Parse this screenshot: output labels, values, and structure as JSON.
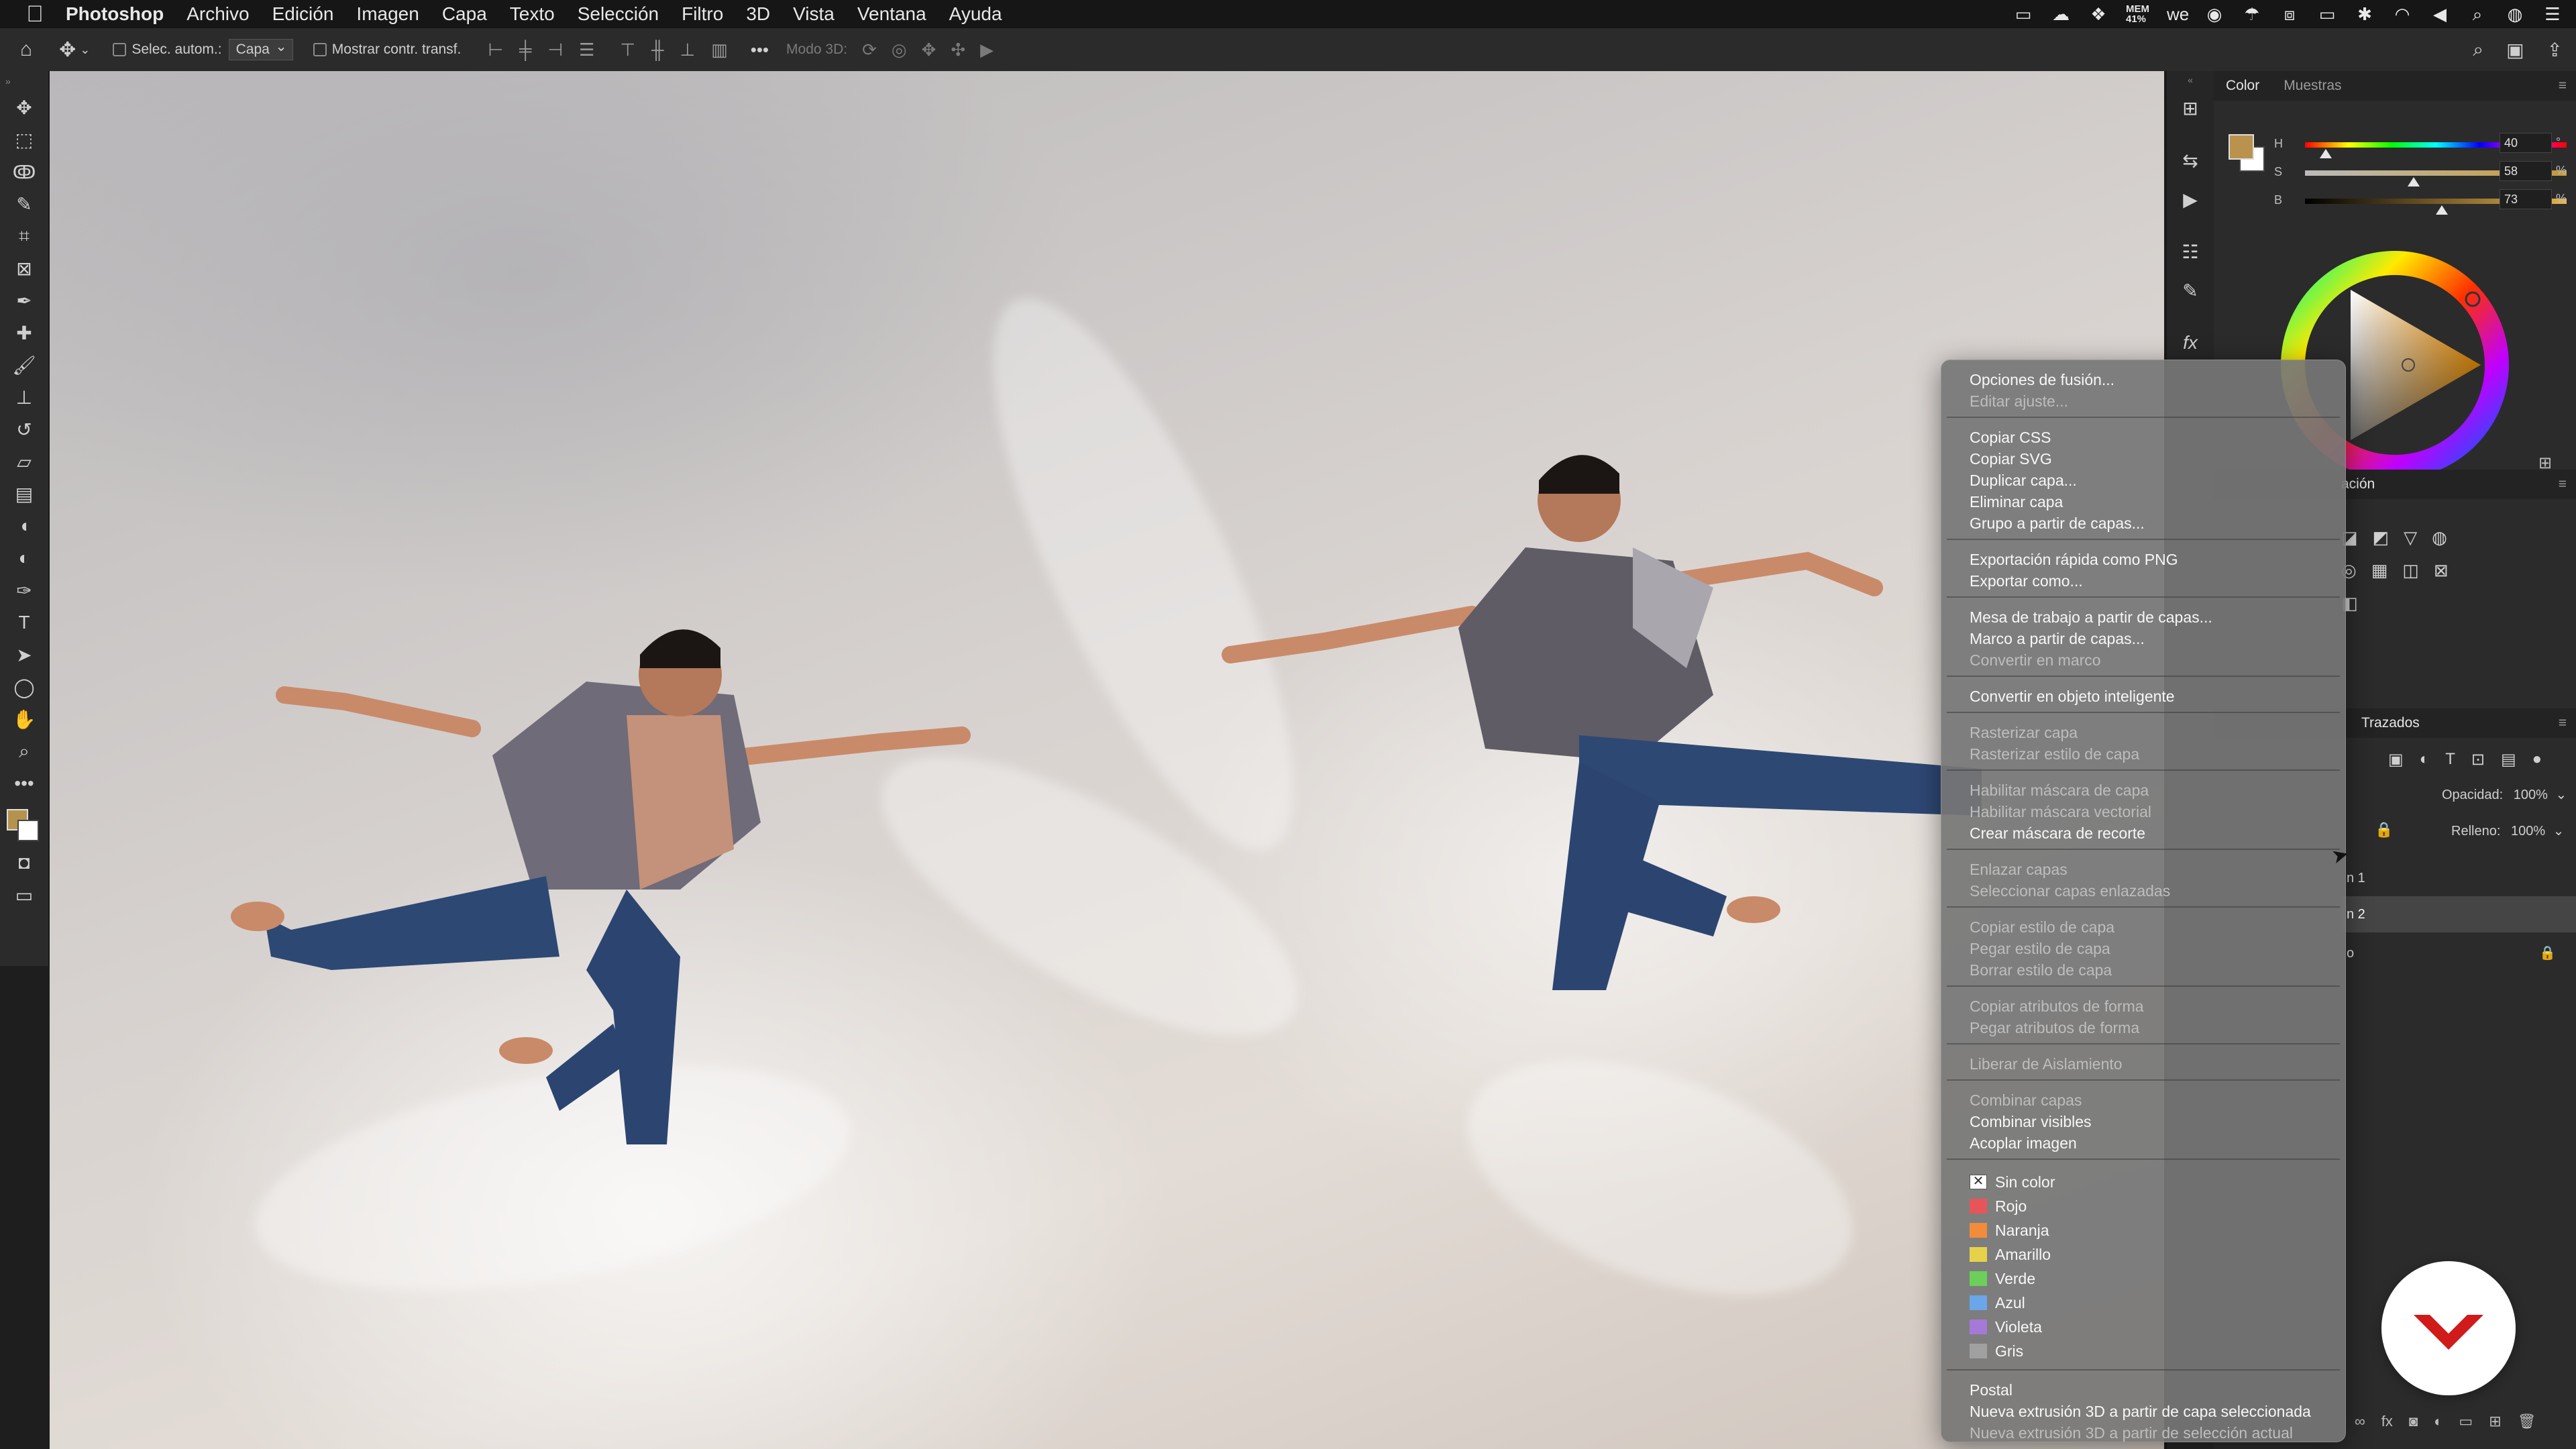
{
  "menubar": {
    "app_name": "Photoshop",
    "menus": [
      "Archivo",
      "Edición",
      "Imagen",
      "Capa",
      "Texto",
      "Selección",
      "Filtro",
      "3D",
      "Vista",
      "Ventana",
      "Ayuda"
    ],
    "status": {
      "memory_label": "MEM",
      "memory_value": "41%"
    }
  },
  "options_bar": {
    "auto_select_label": "Selec. autom.:",
    "auto_select_value": "Capa",
    "show_transform_label": "Mostrar contr. transf.",
    "mode_3d_label": "Modo 3D:"
  },
  "color_panel": {
    "tabs": [
      "Color",
      "Muestras"
    ],
    "h_label": "H",
    "h_value": "40",
    "h_unit": "°",
    "s_label": "S",
    "s_value": "58",
    "s_unit": "%",
    "b_label": "B",
    "b_value": "73",
    "b_unit": "%",
    "h_fraction": 0.11,
    "s_fraction": 0.58,
    "b_fraction": 0.73,
    "fg_color": "#b9934e",
    "bg_color": "#ffffff"
  },
  "adjust_panel": {
    "partial_title": "ación"
  },
  "layers_panel": {
    "partial_tab": "Trazados",
    "opacity_label": "Opacidad:",
    "opacity_value": "100%",
    "fill_label": "Relleno:",
    "fill_value": "100%",
    "layer_1_partial": "n 1",
    "layer_2_partial": "n 2",
    "layer_3_partial": "o"
  },
  "context_menu": {
    "items": [
      {
        "label": "Opciones de fusión...",
        "enabled": true
      },
      {
        "label": "Editar ajuste...",
        "enabled": false
      },
      {
        "sep": true
      },
      {
        "label": "Copiar CSS",
        "enabled": true
      },
      {
        "label": "Copiar SVG",
        "enabled": true
      },
      {
        "label": "Duplicar capa...",
        "enabled": true
      },
      {
        "label": "Eliminar capa",
        "enabled": true
      },
      {
        "label": "Grupo a partir de capas...",
        "enabled": true
      },
      {
        "sep": true
      },
      {
        "label": "Exportación rápida como PNG",
        "enabled": true
      },
      {
        "label": "Exportar como...",
        "enabled": true
      },
      {
        "sep": true
      },
      {
        "label": "Mesa de trabajo a partir de capas...",
        "enabled": true
      },
      {
        "label": "Marco a partir de capas...",
        "enabled": true
      },
      {
        "label": "Convertir en marco",
        "enabled": false
      },
      {
        "sep": true
      },
      {
        "label": "Convertir en objeto inteligente",
        "enabled": true
      },
      {
        "sep": true
      },
      {
        "label": "Rasterizar capa",
        "enabled": false
      },
      {
        "label": "Rasterizar estilo de capa",
        "enabled": false
      },
      {
        "sep": true
      },
      {
        "label": "Habilitar máscara de capa",
        "enabled": false
      },
      {
        "label": "Habilitar máscara vectorial",
        "enabled": false
      },
      {
        "label": "Crear máscara de recorte",
        "enabled": true
      },
      {
        "sep": true
      },
      {
        "label": "Enlazar capas",
        "enabled": false
      },
      {
        "label": "Seleccionar capas enlazadas",
        "enabled": false
      },
      {
        "sep": true
      },
      {
        "label": "Copiar estilo de capa",
        "enabled": false
      },
      {
        "label": "Pegar estilo de capa",
        "enabled": false
      },
      {
        "label": "Borrar estilo de capa",
        "enabled": false
      },
      {
        "sep": true
      },
      {
        "label": "Copiar atributos de forma",
        "enabled": false
      },
      {
        "label": "Pegar atributos de forma",
        "enabled": false
      },
      {
        "sep": true
      },
      {
        "label": "Liberar de Aislamiento",
        "enabled": false
      },
      {
        "sep": true
      },
      {
        "label": "Combinar capas",
        "enabled": false
      },
      {
        "label": "Combinar visibles",
        "enabled": true
      },
      {
        "label": "Acoplar imagen",
        "enabled": true
      },
      {
        "sep": true
      }
    ],
    "colors": [
      {
        "label": "Sin color",
        "color": "none"
      },
      {
        "label": "Rojo",
        "color": "#e6555a"
      },
      {
        "label": "Naranja",
        "color": "#f08c3a"
      },
      {
        "label": "Amarillo",
        "color": "#e6d24a"
      },
      {
        "label": "Verde",
        "color": "#6ccf5a"
      },
      {
        "label": "Azul",
        "color": "#6aa6e8"
      },
      {
        "label": "Violeta",
        "color": "#a579d8"
      },
      {
        "label": "Gris",
        "color": "#a0a0a0"
      }
    ],
    "tail": [
      {
        "label": "Postal",
        "enabled": true
      },
      {
        "label": "Nueva extrusión 3D a partir de capa seleccionada",
        "enabled": true
      },
      {
        "label": "Nueva extrusión 3D a partir de selección actual",
        "enabled": false
      }
    ]
  },
  "brand": {
    "logo_color": "#d11a1a"
  }
}
